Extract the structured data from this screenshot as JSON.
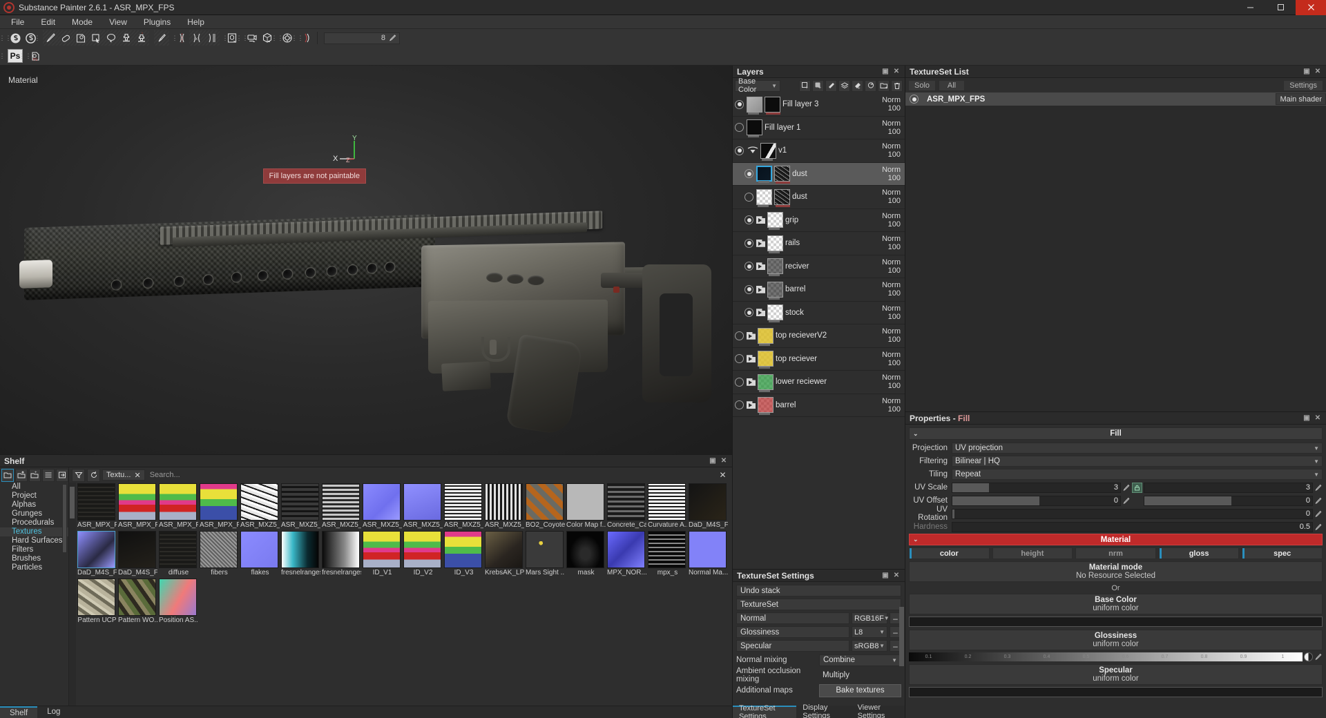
{
  "window": {
    "title": "Substance Painter 2.6.1 - ASR_MPX_FPS",
    "minimize": "–",
    "maximize": "▢",
    "close": "✕"
  },
  "menu": {
    "items": [
      "File",
      "Edit",
      "Mode",
      "View",
      "Plugins",
      "Help"
    ]
  },
  "toolbar": {
    "brush_size": "8",
    "icons": [
      "substance-logo-icon",
      "substance-alt-icon",
      "paint-brush-icon",
      "eraser-icon",
      "projection-icon",
      "geometry-fill-icon",
      "lasso-fill-icon",
      "clone-stamp-icon",
      "smudge-stamp-icon",
      "particle-brush-icon",
      "symmetry-open-icon",
      "symmetry-close-icon",
      "symmetry-x-icon",
      "symmetry-mirror-icon",
      "bake-cube-icon",
      "camera-icon",
      "cube-icon",
      "render-icon",
      "curve-icon"
    ],
    "row2_icons": [
      "photoshop-icon",
      "export-icon"
    ]
  },
  "viewport": {
    "label": "Material",
    "warning": "Fill layers are not paintable",
    "axes": {
      "x": "X",
      "y": "Y",
      "z": "Z"
    }
  },
  "layers_panel": {
    "title": "Layers",
    "channel": "Base Color",
    "toolbar_icons": [
      "add-paint-layer-icon",
      "add-fill-layer-icon",
      "add-mask-icon",
      "add-folder-stack-icon",
      "add-fill-effect-icon",
      "add-generator-icon",
      "add-group-icon",
      "delete-layer-icon"
    ],
    "rows": [
      {
        "name": "Fill layer 3",
        "blend": "Norm",
        "opacity": "100",
        "visible": true,
        "selected": false,
        "indent": 0,
        "kind": "fill",
        "thumb": "grey",
        "mask": "black"
      },
      {
        "name": "Fill layer 1",
        "blend": "Norm",
        "opacity": "100",
        "visible": false,
        "selected": false,
        "indent": 0,
        "kind": "fill",
        "thumb": "black",
        "mask": null
      },
      {
        "name": "v1",
        "blend": "Norm",
        "opacity": "100",
        "visible": true,
        "selected": false,
        "indent": 0,
        "kind": "group",
        "thumb": "blackwhite",
        "mask": null
      },
      {
        "name": "dust",
        "blend": "Norm",
        "opacity": "100",
        "visible": true,
        "selected": true,
        "indent": 1,
        "kind": "fill",
        "thumb": "darkblue",
        "mask": "noise"
      },
      {
        "name": "dust",
        "blend": "Norm",
        "opacity": "100",
        "visible": false,
        "selected": false,
        "indent": 1,
        "kind": "fill",
        "thumb": "checker",
        "mask": "noise"
      },
      {
        "name": "grip",
        "blend": "Norm",
        "opacity": "100",
        "visible": true,
        "selected": false,
        "indent": 1,
        "kind": "folder",
        "thumb": "checker",
        "mask": null
      },
      {
        "name": "rails",
        "blend": "Norm",
        "opacity": "100",
        "visible": true,
        "selected": false,
        "indent": 1,
        "kind": "folder",
        "thumb": "checker",
        "mask": null
      },
      {
        "name": "reciver",
        "blend": "Norm",
        "opacity": "100",
        "visible": true,
        "selected": false,
        "indent": 1,
        "kind": "folder",
        "thumb": "checkerdark",
        "mask": null
      },
      {
        "name": "barrel",
        "blend": "Norm",
        "opacity": "100",
        "visible": true,
        "selected": false,
        "indent": 1,
        "kind": "folder",
        "thumb": "checkerdark",
        "mask": null
      },
      {
        "name": "stock",
        "blend": "Norm",
        "opacity": "100",
        "visible": true,
        "selected": false,
        "indent": 1,
        "kind": "folder",
        "thumb": "checker",
        "mask": null
      },
      {
        "name": "top recieverV2",
        "blend": "Norm",
        "opacity": "100",
        "visible": false,
        "selected": false,
        "indent": 0,
        "kind": "folder",
        "thumb": "yellow",
        "mask": null
      },
      {
        "name": "top reciever",
        "blend": "Norm",
        "opacity": "100",
        "visible": false,
        "selected": false,
        "indent": 0,
        "kind": "folder",
        "thumb": "yellow",
        "mask": null
      },
      {
        "name": "lower reciewer",
        "blend": "Norm",
        "opacity": "100",
        "visible": false,
        "selected": false,
        "indent": 0,
        "kind": "folder",
        "thumb": "green",
        "mask": null
      },
      {
        "name": "barrel",
        "blend": "Norm",
        "opacity": "100",
        "visible": false,
        "selected": false,
        "indent": 0,
        "kind": "folder",
        "thumb": "red",
        "mask": null
      }
    ]
  },
  "textureset_settings": {
    "title": "TextureSet Settings",
    "undo_stack": "Undo stack",
    "textureset": "TextureSet",
    "maps": [
      {
        "name": "Normal",
        "format": "RGB16F"
      },
      {
        "name": "Glossiness",
        "format": "L8"
      },
      {
        "name": "Specular",
        "format": "sRGB8"
      }
    ],
    "normal_mixing_label": "Normal mixing",
    "normal_mixing_value": "Combine",
    "ao_mixing_label": "Ambient occlusion mixing",
    "ao_mixing_value": "Multiply",
    "additional_maps_label": "Additional maps",
    "bake_button": "Bake textures",
    "tabs": [
      {
        "label": "TextureSet Settings",
        "active": true
      },
      {
        "label": "Display Settings",
        "active": false
      },
      {
        "label": "Viewer Settings",
        "active": false
      }
    ]
  },
  "textureset_list": {
    "title": "TextureSet List",
    "solo": "Solo",
    "all": "All",
    "settings": "Settings",
    "entry_name": "ASR_MPX_FPS",
    "entry_shader": "Main shader"
  },
  "properties": {
    "title_main": "Properties - ",
    "title_sub": "Fill",
    "fill_header": "Fill",
    "rows": [
      {
        "label": "Projection",
        "value": "UV projection",
        "type": "select"
      },
      {
        "label": "Filtering",
        "value": "Bilinear | HQ",
        "type": "select"
      },
      {
        "label": "Tiling",
        "value": "Repeat",
        "type": "select"
      }
    ],
    "uv_scale_label": "UV Scale",
    "uv_scale_x": "3",
    "uv_scale_y": "3",
    "uv_offset_label": "UV Offset",
    "uv_offset_x": "0",
    "uv_offset_y": "0",
    "uv_rotation_label": "UV Rotation",
    "uv_rotation": "0",
    "hardness_label": "Hardness",
    "hardness": "0.5",
    "material_header": "Material",
    "channels": [
      {
        "label": "color",
        "on": true
      },
      {
        "label": "height",
        "on": false
      },
      {
        "label": "nrm",
        "on": false
      },
      {
        "label": "gloss",
        "on": true
      },
      {
        "label": "spec",
        "on": true
      }
    ],
    "material_mode_title": "Material mode",
    "material_mode_value": "No Resource Selected",
    "or": "Or",
    "base_color_title": "Base Color",
    "base_color_value": "uniform color",
    "base_color_hex": "#1b1b1b",
    "glossiness_title": "Glossiness",
    "glossiness_value": "uniform color",
    "glossiness_ticks": [
      "0.1",
      "0.2",
      "0.3",
      "0.4",
      "0.5",
      "0.6",
      "0.7",
      "0.8",
      "0.9",
      "1"
    ],
    "specular_title": "Specular",
    "specular_value": "uniform color",
    "specular_hex": "#050505"
  },
  "shelf": {
    "title": "Shelf",
    "tool_icons": [
      "folder-icon",
      "import-icon",
      "new-resource-icon",
      "list-view-icon",
      "export-shelf-icon"
    ],
    "filter_icon": "filter-icon",
    "reset_icon": "reset-icon",
    "tag": "Textu...",
    "tag_close": "✕",
    "search_placeholder": "Search...",
    "categories": [
      {
        "label": "All",
        "selected": false
      },
      {
        "label": "Project",
        "selected": false
      },
      {
        "label": "Alphas",
        "selected": false
      },
      {
        "label": "Grunges",
        "selected": false
      },
      {
        "label": "Procedurals",
        "selected": false
      },
      {
        "label": "Textures",
        "selected": true
      },
      {
        "label": "Hard Surfaces",
        "selected": false
      },
      {
        "label": "Filters",
        "selected": false
      },
      {
        "label": "Brushes",
        "selected": false
      },
      {
        "label": "Particles",
        "selected": false
      }
    ],
    "tiles_row1": [
      {
        "label": "ASR_MPX_F...",
        "style": "tex-dark-panel"
      },
      {
        "label": "ASR_MPX_F...",
        "style": "tex-id-map"
      },
      {
        "label": "ASR_MPX_F...",
        "style": "tex-id-map"
      },
      {
        "label": "ASR_MPX_F...",
        "style": "tex-id-map2"
      },
      {
        "label": "ASR_MXZ5_...",
        "style": "tex-bw-noise"
      },
      {
        "label": "ASR_MXZ5_...",
        "style": "tex-grey-panel"
      },
      {
        "label": "ASR_MXZ5_...",
        "style": "tex-grey-panel2"
      },
      {
        "label": "ASR_MXZ5_...",
        "style": "tex-blue-normal"
      },
      {
        "label": "ASR_MXZ5_...",
        "style": "tex-blue-normal2"
      },
      {
        "label": "ASR_MXZ5_...",
        "style": "tex-bw-panel"
      },
      {
        "label": "ASR_MXZ5_...",
        "style": "tex-bw-panel2"
      },
      {
        "label": "BO2_Coyote",
        "style": "tex-rust"
      },
      {
        "label": "Color Map f...",
        "style": "tex-flatgrey"
      },
      {
        "label": "Concrete_Ca...",
        "style": "tex-concrete"
      },
      {
        "label": "Curvature A...",
        "style": "tex-curvature"
      },
      {
        "label": "DaD_M4S_F...",
        "style": "tex-dark1"
      },
      {
        "label": "DaD_M4S_F...",
        "style": "tex-purple",
        "selected": true
      },
      {
        "label": "DaD_M4S_F...",
        "style": "tex-dark2"
      }
    ],
    "tiles_row2": [
      {
        "label": "diffuse",
        "style": "tex-dark-panel"
      },
      {
        "label": "fibers",
        "style": "tex-fibers"
      },
      {
        "label": "flakes",
        "style": "tex-flakes"
      },
      {
        "label": "fresnelranges",
        "style": "tex-fresnel"
      },
      {
        "label": "fresnelranges2",
        "style": "tex-fresnel2"
      },
      {
        "label": "ID_V1",
        "style": "tex-id-map"
      },
      {
        "label": "ID_V2",
        "style": "tex-id-map"
      },
      {
        "label": "ID_V3",
        "style": "tex-id-map2"
      },
      {
        "label": "KrebsAK_LP...",
        "style": "tex-krebs"
      },
      {
        "label": "Mars Sight ...",
        "style": "tex-marssight"
      },
      {
        "label": "mask",
        "style": "tex-mask"
      },
      {
        "label": "MPX_NOR...",
        "style": "tex-mpxnor"
      },
      {
        "label": "mpx_s",
        "style": "tex-mpxs"
      },
      {
        "label": "Normal Ma...",
        "style": "tex-normalflat"
      },
      {
        "label": "Pattern UCP",
        "style": "tex-ucp"
      },
      {
        "label": "Pattern WO...",
        "style": "tex-woodland"
      },
      {
        "label": "Position AS...",
        "style": "tex-position"
      }
    ],
    "tabs": [
      {
        "label": "Shelf",
        "active": true
      },
      {
        "label": "Log",
        "active": false
      }
    ]
  }
}
